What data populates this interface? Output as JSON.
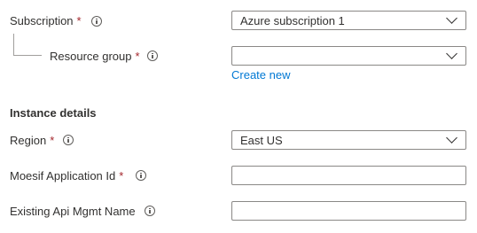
{
  "subscription": {
    "label": "Subscription",
    "required_mark": "*",
    "value": "Azure subscription 1"
  },
  "resource_group": {
    "label": "Resource group",
    "required_mark": "*",
    "value": "",
    "create_new": "Create new"
  },
  "instance_details": {
    "title": "Instance details"
  },
  "region": {
    "label": "Region",
    "required_mark": "*",
    "value": "East US"
  },
  "moesif_app_id": {
    "label": "Moesif Application Id",
    "required_mark": "*",
    "value": ""
  },
  "api_mgmt_name": {
    "label": "Existing Api Mgmt Name",
    "value": ""
  },
  "colors": {
    "text": "#323130",
    "required": "#a4262c",
    "link": "#0078d4",
    "border": "#8a8886"
  }
}
